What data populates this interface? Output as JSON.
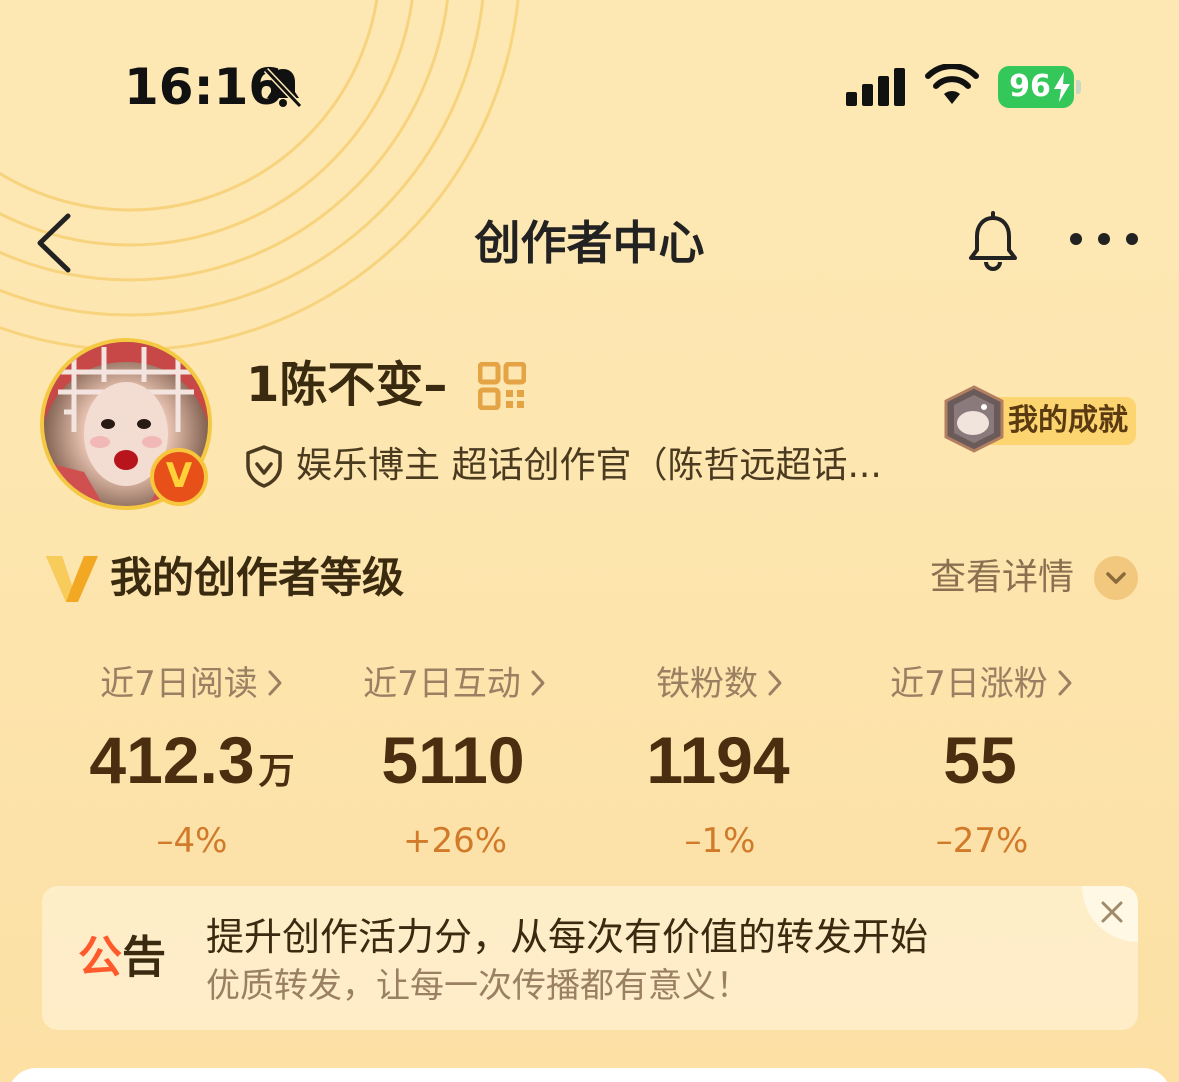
{
  "status_bar": {
    "time": "16:16",
    "battery": "96",
    "icons": [
      "bell-slash-icon",
      "signal-icon",
      "wifi-icon",
      "battery-icon"
    ]
  },
  "nav": {
    "title": "创作者中心",
    "icons": [
      "back-chevron-icon",
      "bell-icon",
      "more-icon"
    ]
  },
  "profile": {
    "username": "1陈不变–",
    "bio": "娱乐博主 超话创作官（陈哲远超话...",
    "badge": "V",
    "achievement_label": "我的成就"
  },
  "level": {
    "title": "我的创作者等级",
    "detail_label": "查看详情"
  },
  "stats": [
    {
      "label": "近7日阅读",
      "value": "412.3",
      "unit": "万",
      "change": "–4%"
    },
    {
      "label": "近7日互动",
      "value": "5110",
      "unit": "",
      "change": "+26%"
    },
    {
      "label": "铁粉数",
      "value": "1194",
      "unit": "",
      "change": "–1%"
    },
    {
      "label": "近7日涨粉",
      "value": "55",
      "unit": "",
      "change": "–27%"
    }
  ],
  "notice": {
    "tag_a": "公",
    "tag_b": "告",
    "title": "提升创作活力分，从每次有价值的转发开始",
    "subtitle": "优质转发，让每一次传播都有意义！"
  },
  "colors": {
    "background": "#fde6b0",
    "accent_orange": "#d07a2a",
    "battery_green": "#34c759",
    "notice_red": "#ff5a2c"
  }
}
